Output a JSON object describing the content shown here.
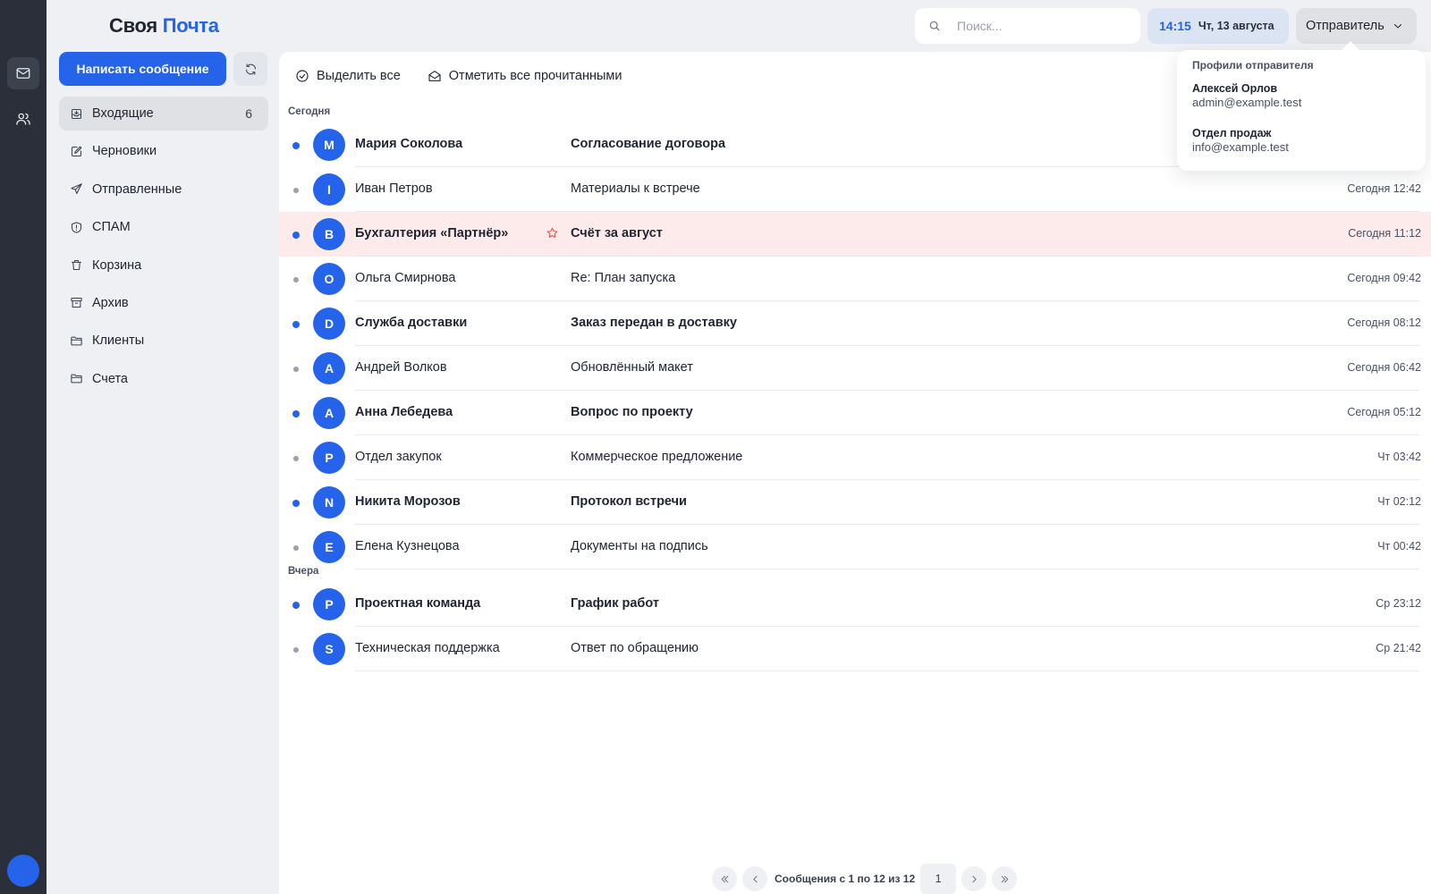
{
  "app": {
    "logo_part1": "Своя",
    "logo_part2": "Почта"
  },
  "sidebar": {
    "compose_label": "Написать сообщение",
    "folders": [
      {
        "label": "Входящие",
        "count": "6",
        "icon": "inbox-icon",
        "active": true
      },
      {
        "label": "Черновики",
        "icon": "pencil-icon"
      },
      {
        "label": "Отправленные",
        "icon": "send-icon"
      },
      {
        "label": "СПАМ",
        "icon": "shield-icon"
      },
      {
        "label": "Корзина",
        "icon": "trash-icon"
      },
      {
        "label": "Архив",
        "icon": "archive-icon"
      },
      {
        "label": "Клиенты",
        "icon": "folder-icon"
      },
      {
        "label": "Счета",
        "icon": "folder-icon"
      }
    ]
  },
  "header": {
    "search_placeholder": "Поиск...",
    "clock_time": "14:15",
    "clock_date": "Чт, 13 августа",
    "sender_label": "Отправитель"
  },
  "toolbar": {
    "select_all": "Выделить все",
    "mark_all_read": "Отметить все прочитанными"
  },
  "groups": {
    "today": "Сегодня",
    "yesterday": "Вчера"
  },
  "messages_today": [
    {
      "avatar": "M",
      "from": "Мария Соколова",
      "subject": "Согласование договора",
      "time": "",
      "unread": true
    },
    {
      "avatar": "I",
      "from": "Иван Петров",
      "subject": "Материалы к встрече",
      "time": "Сегодня 12:42",
      "unread": false
    },
    {
      "avatar": "B",
      "from": "Бухгалтерия «Партнёр»",
      "subject": "Счёт за август",
      "time": "Сегодня 11:12",
      "unread": true,
      "flagged": true
    },
    {
      "avatar": "O",
      "from": "Ольга Смирнова",
      "subject": "Re: План запуска",
      "time": "Сегодня 09:42",
      "unread": false
    },
    {
      "avatar": "D",
      "from": "Служба доставки",
      "subject": "Заказ передан в доставку",
      "time": "Сегодня 08:12",
      "unread": true
    },
    {
      "avatar": "A",
      "from": "Андрей Волков",
      "subject": "Обновлённый макет",
      "time": "Сегодня 06:42",
      "unread": false
    },
    {
      "avatar": "A",
      "from": "Анна Лебедева",
      "subject": "Вопрос по проекту",
      "time": "Сегодня 05:12",
      "unread": true
    },
    {
      "avatar": "P",
      "from": "Отдел закупок",
      "subject": "Коммерческое предложение",
      "time": "Чт 03:42",
      "unread": false
    },
    {
      "avatar": "N",
      "from": "Никита Морозов",
      "subject": "Протокол встречи",
      "time": "Чт 02:12",
      "unread": true
    },
    {
      "avatar": "E",
      "from": "Елена Кузнецова",
      "subject": "Документы на подпись",
      "time": "Чт 00:42",
      "unread": false
    }
  ],
  "messages_yesterday": [
    {
      "avatar": "P",
      "from": "Проектная команда",
      "subject": "График работ",
      "time": "Ср 23:12",
      "unread": true
    },
    {
      "avatar": "S",
      "from": "Техническая поддержка",
      "subject": "Ответ по обращению",
      "time": "Ср 21:42",
      "unread": false
    }
  ],
  "pagination": {
    "info": "Сообщения с 1 по 12 из 12",
    "page": "1"
  },
  "sender_dropdown": {
    "title": "Профили отправителя",
    "profiles": [
      {
        "name": "Алексей Орлов",
        "email": "admin@example.test"
      },
      {
        "name": "Отдел продаж",
        "email": "info@example.test"
      }
    ]
  },
  "colors": {
    "accent": "#2563eb",
    "rail": "#2a2f3a",
    "flagged_row": "#fdebec",
    "star": "#e24b4b"
  }
}
